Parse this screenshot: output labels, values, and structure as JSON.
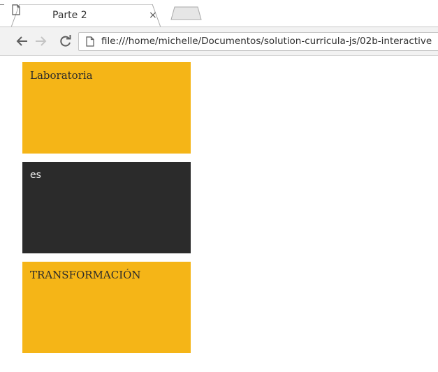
{
  "browser": {
    "tab": {
      "title": "Parte 2",
      "close_glyph": "×",
      "icon": "document-icon"
    },
    "new_tab_icon": "new-tab-icon",
    "nav": {
      "back_icon": "arrow-left-icon",
      "forward_icon": "arrow-right-icon",
      "reload_icon": "reload-icon"
    },
    "address_bar": {
      "icon": "page-icon",
      "url": "file:///home/michelle/Documentos/solution-curricula-js/02b-interactive"
    }
  },
  "page": {
    "boxes": [
      {
        "text": "Laboratoria",
        "background": "#f5b517",
        "color": "#2a2a2a"
      },
      {
        "text": "es",
        "background": "#2b2b2b",
        "color": "#f0f0f0"
      },
      {
        "text": "TRANSFORMACIÓN",
        "background": "#f5b517",
        "color": "#2a2a2a"
      }
    ]
  }
}
